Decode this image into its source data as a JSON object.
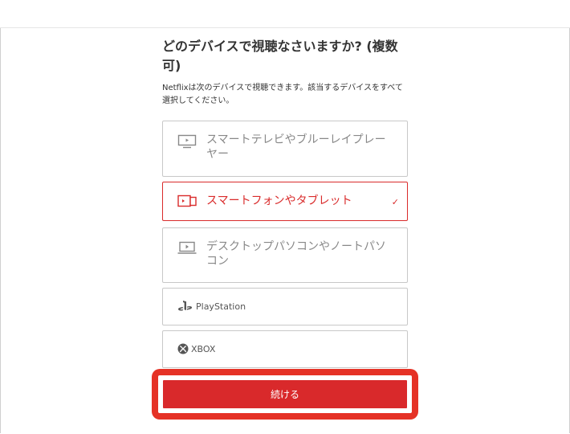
{
  "heading": "どのデバイスで視聴なさいますか? (複数可)",
  "description": "Netflixは次のデバイスで視聴できます。該当するデバイスをすべて選択してください。",
  "options": [
    {
      "label": "スマートテレビやブルーレイプレーヤー",
      "icon": "tv-icon",
      "selected": false
    },
    {
      "label": "スマートフォンやタブレット",
      "icon": "phone-tablet-icon",
      "selected": true
    },
    {
      "label": "デスクトップパソコンやノートパソコン",
      "icon": "laptop-icon",
      "selected": false
    },
    {
      "label": "PlayStation",
      "icon": "playstation-icon",
      "selected": false
    },
    {
      "label": "XBOX",
      "icon": "xbox-icon",
      "selected": false
    }
  ],
  "check_mark": "✓",
  "continue_label": "続ける",
  "colors": {
    "accent": "#d9292b",
    "highlight": "#e53226",
    "border": "#c8c8c8",
    "muted_text": "#888888"
  }
}
